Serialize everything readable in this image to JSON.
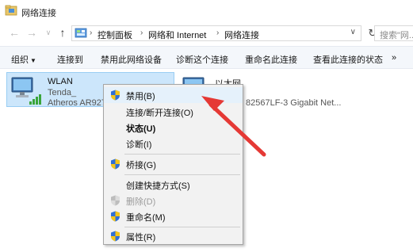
{
  "window": {
    "title": "网络连接"
  },
  "nav": {
    "breadcrumb": [
      "控制面板",
      "网络和 Internet",
      "网络连接"
    ],
    "search_placeholder": "搜索\"网..."
  },
  "commands": {
    "organize": "组织",
    "connect_to": "连接到",
    "disable_device": "禁用此网络设备",
    "diagnose": "诊断这个连接",
    "rename": "重命名此连接",
    "view_status": "查看此连接的状态",
    "more": "»"
  },
  "adapters": [
    {
      "name": "WLAN",
      "network": "Tenda_",
      "device": "Atheros AR927",
      "selected": true
    },
    {
      "name": "以太网",
      "network": "",
      "device": "82567LF-3 Gigabit Net...",
      "selected": false
    }
  ],
  "context_menu": {
    "items": [
      {
        "label": "禁用(B)",
        "shield": true,
        "bold": false,
        "disabled": false,
        "hover": true
      },
      {
        "label": "连接/断开连接(O)",
        "shield": false,
        "bold": false,
        "disabled": false
      },
      {
        "label": "状态(U)",
        "shield": false,
        "bold": true,
        "disabled": false
      },
      {
        "label": "诊断(I)",
        "shield": false,
        "bold": false,
        "disabled": false
      },
      {
        "label": "桥接(G)",
        "shield": true,
        "bold": false,
        "disabled": false
      },
      {
        "label": "创建快捷方式(S)",
        "shield": false,
        "bold": false,
        "disabled": false
      },
      {
        "label": "删除(D)",
        "shield": true,
        "bold": false,
        "disabled": true
      },
      {
        "label": "重命名(M)",
        "shield": true,
        "bold": false,
        "disabled": false
      },
      {
        "label": "属性(R)",
        "shield": true,
        "bold": false,
        "disabled": false
      }
    ]
  },
  "colors": {
    "selection": "#cce6fb",
    "arrow": "#e53935",
    "menu_bg": "#f2f2f2"
  }
}
